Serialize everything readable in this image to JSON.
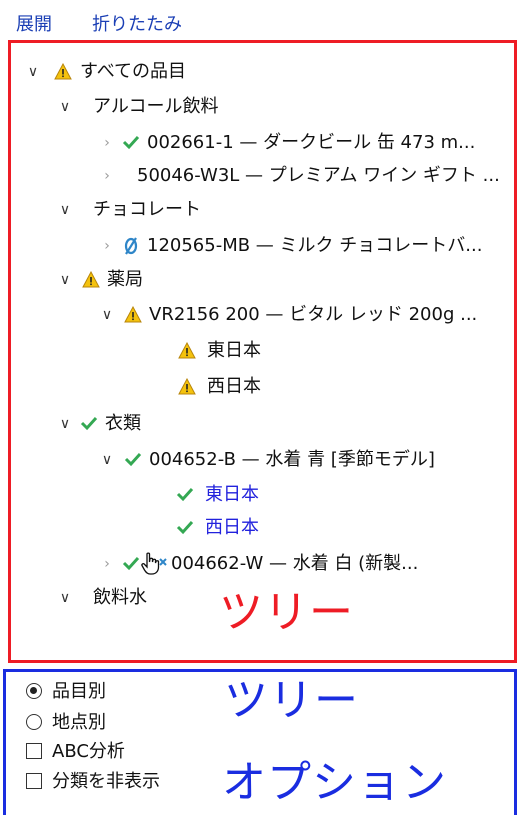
{
  "toolbar": {
    "expand_label": "展開",
    "collapse_label": "折りたたみ"
  },
  "tree": {
    "caption": "ツリー",
    "nodes": {
      "root": "すべての品目",
      "alcohol": "アルコール飲料",
      "beer": "002661-1 — ダークビール 缶 473 m...",
      "wine": "50046-W3L — プレミアム ワイン ギフト ...",
      "chocolate": "チョコレート",
      "milk_choc": "120565-MB — ミルク チョコレートバ...",
      "pharmacy": "薬局",
      "vitared": "VR2156 200 — ビタル レッド 200g ...",
      "east_warn": "東日本",
      "west_warn": "西日本",
      "clothing": "衣類",
      "swimsuit_blue": "004652-B — 水着 青 [季節モデル]",
      "east_ok": "東日本",
      "west_ok": "西日本",
      "swimsuit_white": "004662-W — 水着 白 (新製...",
      "water": "飲料水"
    }
  },
  "options": {
    "caption_line1": "ツリー",
    "caption_line2": "オプション",
    "by_item": "品目別",
    "by_location": "地点別",
    "abc": "ABC分析",
    "hide_categories": "分類を非表示",
    "selected_view": "品目別"
  },
  "colors": {
    "tree_border": "#ee1c25",
    "options_border": "#1a2de0",
    "link": "#1b3fb5",
    "check": "#34a853",
    "warning": "#e8b400"
  }
}
